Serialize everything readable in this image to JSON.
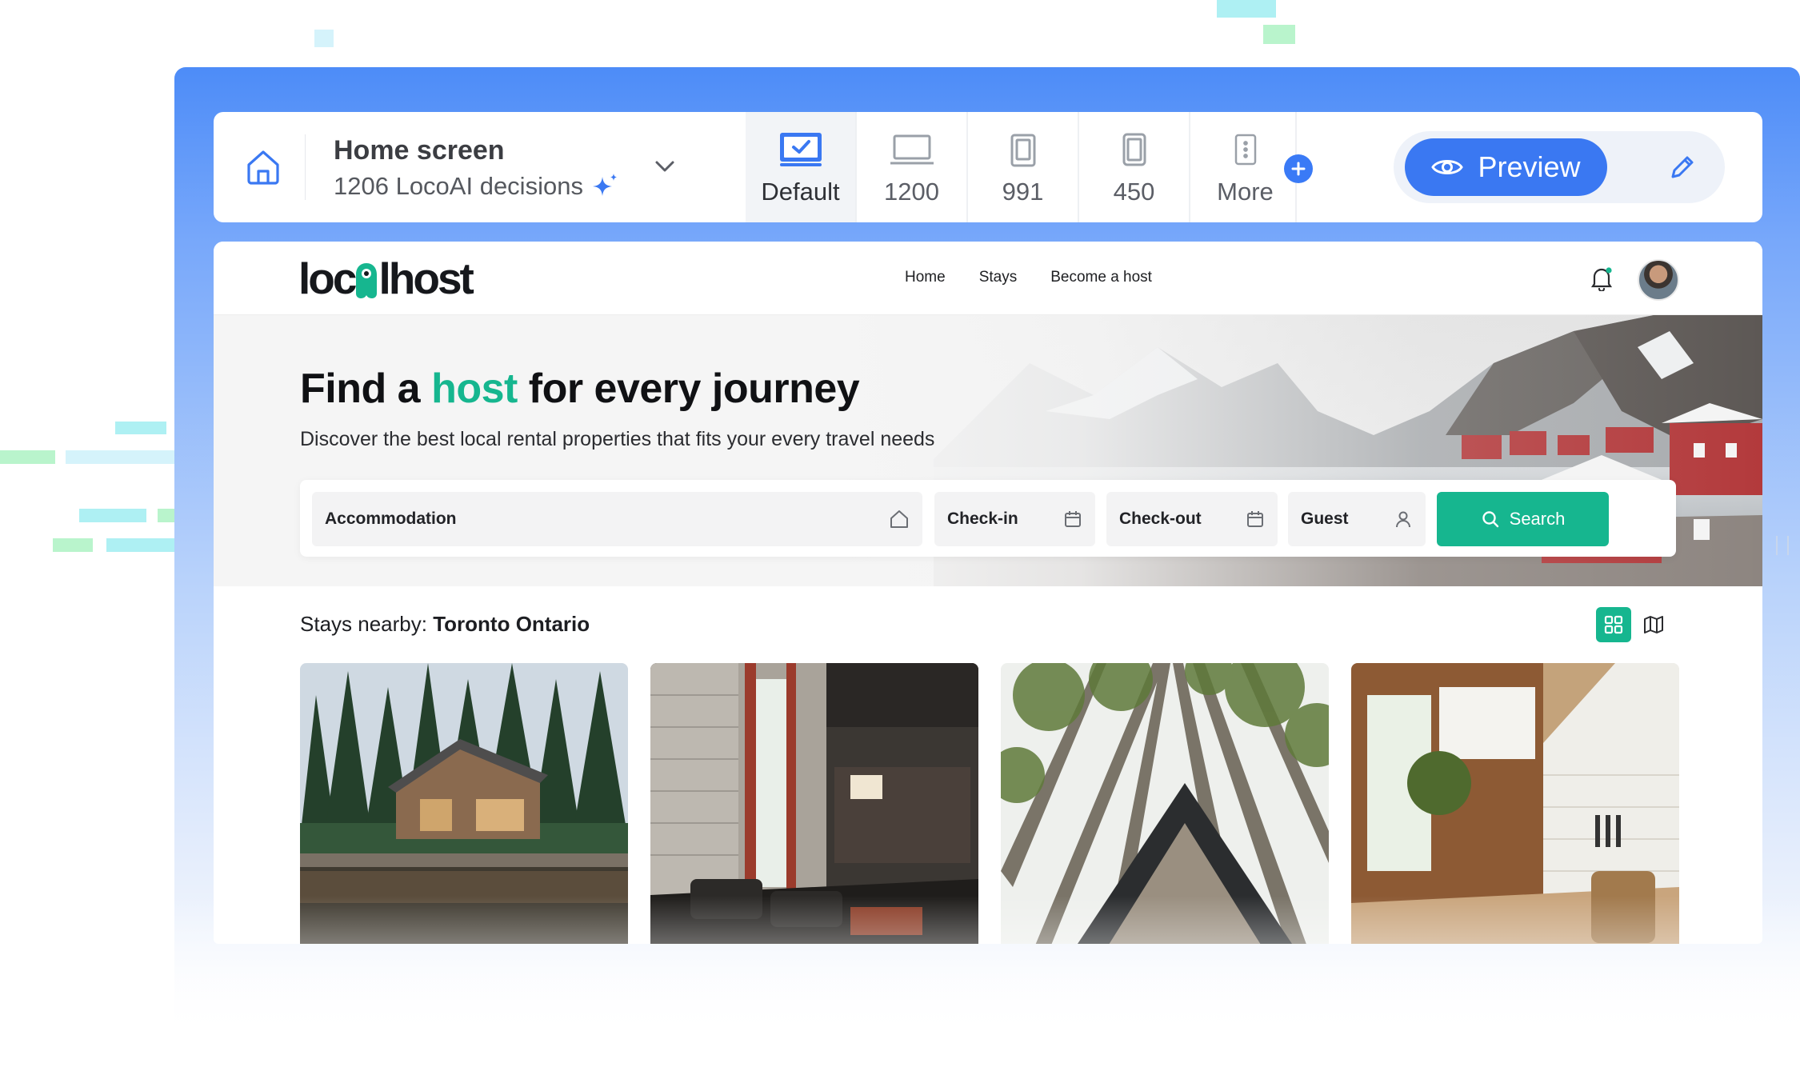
{
  "toolbar": {
    "screen_title": "Home screen",
    "screen_subtitle": "1206 LocoAI decisions",
    "breakpoints": [
      {
        "label": "Default",
        "icon": "monitor-check-icon",
        "active": true
      },
      {
        "label": "1200",
        "icon": "laptop-icon",
        "active": false
      },
      {
        "label": "991",
        "icon": "tablet-icon",
        "active": false
      },
      {
        "label": "450",
        "icon": "mobile-icon",
        "active": false
      },
      {
        "label": "More",
        "icon": "more-vertical-icon",
        "active": false
      }
    ],
    "preview_label": "Preview"
  },
  "app": {
    "logo_text_left": "loc",
    "logo_text_right": "lhost",
    "nav": [
      "Home",
      "Stays",
      "Become a host"
    ],
    "hero_title_pre": "Find a",
    "hero_title_accent": "host",
    "hero_title_post": "for every journey",
    "hero_subtitle": "Discover the best local rental properties that fits your every travel needs",
    "search": {
      "accommodation": "Accommodation",
      "checkin": "Check-in",
      "checkout": "Check-out",
      "guest": "Guest",
      "button": "Search"
    },
    "stays_prefix": "Stays nearby:",
    "stays_location": "Toronto Ontario"
  },
  "colors": {
    "brand_blue": "#3a78f2",
    "accent_green": "#16b68f"
  }
}
